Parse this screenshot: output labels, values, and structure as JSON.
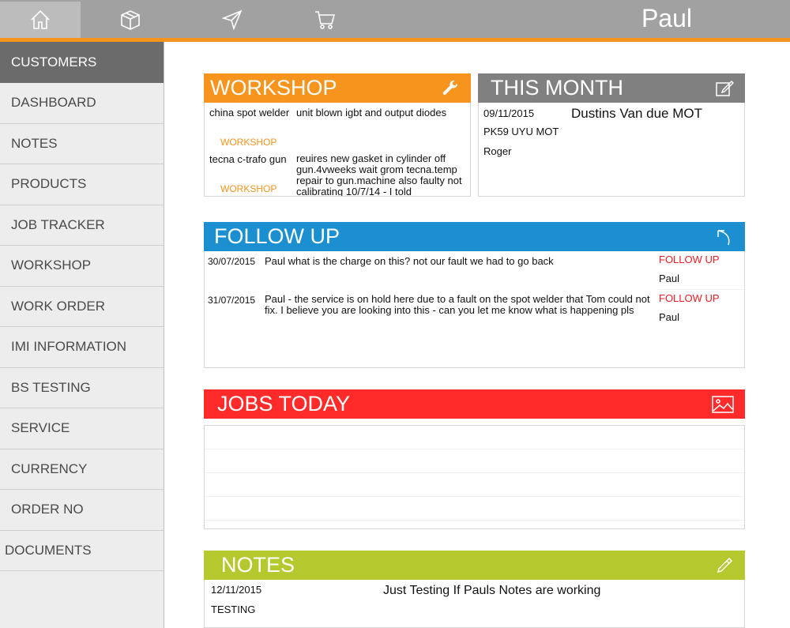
{
  "topbar": {
    "user_name": "Paul",
    "nav": [
      {
        "name": "home-icon"
      },
      {
        "name": "box-icon"
      },
      {
        "name": "send-icon"
      },
      {
        "name": "cart-icon"
      }
    ]
  },
  "sidebar": {
    "items": [
      {
        "label": "CUSTOMERS"
      },
      {
        "label": "DASHBOARD"
      },
      {
        "label": "NOTES"
      },
      {
        "label": "PRODUCTS"
      },
      {
        "label": "JOB TRACKER"
      },
      {
        "label": "WORKSHOP"
      },
      {
        "label": "WORK ORDER"
      },
      {
        "label": "IMI INFORMATION"
      },
      {
        "label": "BS TESTING"
      },
      {
        "label": "SERVICE"
      },
      {
        "label": "CURRENCY"
      },
      {
        "label": "ORDER NO"
      },
      {
        "label": "DOCUMENTS"
      }
    ]
  },
  "workshop": {
    "title": "WORKSHOP",
    "color": "#f7941d",
    "icon": "wrench-icon",
    "rows": [
      {
        "item": "china spot welder",
        "desc": "unit blown igbt and output diodes",
        "tag": "WORKSHOP"
      },
      {
        "item": "tecna c-trafo gun",
        "desc": "reuires new gasket in cylinder off gun.4vweeks wait grom tecna.temp repair to gun.machine also faulty not calibrating 10/7/14 - I told",
        "tag": "WORKSHOP"
      }
    ]
  },
  "this_month": {
    "title": "THIS MONTH",
    "color": "#808080",
    "icon": "edit-icon",
    "date": "09/11/2015",
    "title_text": "Dustins Van due MOT",
    "reg": "PK59 UYU MOT",
    "person": "Roger"
  },
  "follow_up": {
    "title": "FOLLOW UP",
    "color": "#1b8fd0",
    "icon": "arrow-back-icon",
    "rows": [
      {
        "date": "30/07/2015",
        "text": "Paul what is the charge on this? not our fault we had to go back",
        "tag": "FOLLOW UP",
        "person": "Paul"
      },
      {
        "date": "31/07/2015",
        "text": "Paul - the service is on hold here due to a fault on the spot welder that Tom could not fix. I believe you are looking into this - can you let me know what is happening pls",
        "tag": "FOLLOW UP",
        "person": "Paul"
      }
    ]
  },
  "jobs_today": {
    "title": "JOBS TODAY",
    "color": "#ff2b2b",
    "icon": "image-icon"
  },
  "notes": {
    "title": "NOTES",
    "color": "#b5c92e",
    "icon": "pencil-icon",
    "date": "12/11/2015",
    "text": "Just Testing If Pauls Notes are working",
    "tag": "TESTING"
  }
}
